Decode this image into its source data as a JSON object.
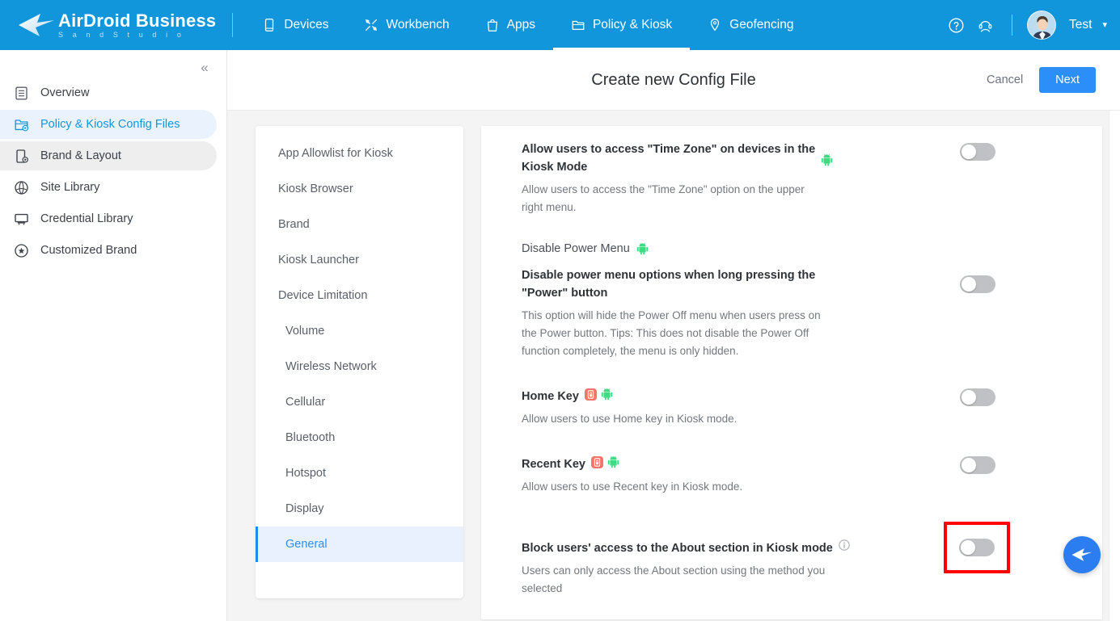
{
  "header": {
    "brand_name": "AirDroid Business",
    "brand_sub": "S a n d   S t u d i o",
    "nav": [
      {
        "label": "Devices",
        "icon": "device-icon",
        "active": false
      },
      {
        "label": "Workbench",
        "icon": "tools-icon",
        "active": false
      },
      {
        "label": "Apps",
        "icon": "apps-bag-icon",
        "active": false
      },
      {
        "label": "Policy & Kiosk",
        "icon": "folder-icon",
        "active": true
      },
      {
        "label": "Geofencing",
        "icon": "location-pin-icon",
        "active": false
      }
    ],
    "help_icon": "help-circle-icon",
    "support_icon": "headset-support-icon",
    "user_name": "Test",
    "user_caret": "⌄",
    "avatar_alt": "user-avatar"
  },
  "sidebar": {
    "collapse_icon": "«",
    "items": [
      {
        "label": "Overview",
        "icon": "document-icon",
        "state": ""
      },
      {
        "label": "Policy & Kiosk Config Files",
        "icon": "folder-gear-icon",
        "state": "selected"
      },
      {
        "label": "Brand & Layout",
        "icon": "device-gear-icon",
        "state": "hovered"
      },
      {
        "label": "Site Library",
        "icon": "globe-icon",
        "state": ""
      },
      {
        "label": "Credential Library",
        "icon": "credential-icon",
        "state": ""
      },
      {
        "label": "Customized Brand",
        "icon": "star-circle-icon",
        "state": ""
      }
    ]
  },
  "page": {
    "title": "Create new Config File",
    "cancel_label": "Cancel",
    "next_label": "Next"
  },
  "subnav": {
    "items": [
      {
        "label": "App Allowlist for Kiosk",
        "child": false,
        "selected": false
      },
      {
        "label": "Kiosk Browser",
        "child": false,
        "selected": false
      },
      {
        "label": "Brand",
        "child": false,
        "selected": false
      },
      {
        "label": "Kiosk Launcher",
        "child": false,
        "selected": false
      },
      {
        "label": "Device Limitation",
        "child": false,
        "selected": false
      },
      {
        "label": "Volume",
        "child": true,
        "selected": false
      },
      {
        "label": "Wireless Network",
        "child": true,
        "selected": false
      },
      {
        "label": "Cellular",
        "child": true,
        "selected": false
      },
      {
        "label": "Bluetooth",
        "child": true,
        "selected": false
      },
      {
        "label": "Hotspot",
        "child": true,
        "selected": false
      },
      {
        "label": "Display",
        "child": true,
        "selected": false
      },
      {
        "label": "General",
        "child": true,
        "selected": true
      }
    ]
  },
  "settings": {
    "rows": [
      {
        "group_label": null,
        "title": "Allow users to access \"Time Zone\" on devices in the Kiosk Mode",
        "desc": "Allow users to access the \"Time Zone\" option on the upper right menu.",
        "badges": [
          "android-robot-icon"
        ],
        "toggle_on": false,
        "highlighted": false
      },
      {
        "group_label": "Disable Power Menu",
        "group_badges": [
          "android-robot-icon"
        ],
        "title": "Disable power menu options when long pressing the \"Power\" button",
        "desc": "This option will hide the Power Off menu when users press on the Power button. Tips: This does not disable the Power Off function completely, the menu is only hidden.",
        "badges": [],
        "toggle_on": false,
        "highlighted": false
      },
      {
        "group_label": null,
        "title": "Home Key",
        "desc": "Allow users to use Home key in Kiosk mode.",
        "badges": [
          "red-device-lock-icon",
          "android-robot-icon"
        ],
        "toggle_on": false,
        "highlighted": false
      },
      {
        "group_label": null,
        "title": "Recent Key",
        "desc": "Allow users to use Recent key in Kiosk mode.",
        "badges": [
          "red-device-lock-icon",
          "android-robot-icon"
        ],
        "toggle_on": false,
        "highlighted": false
      },
      {
        "group_label": null,
        "title": "Block users' access to the About section in Kiosk mode",
        "desc": "Users can only access the About section using the method you selected",
        "badges": [
          "info-circle-icon"
        ],
        "toggle_on": false,
        "highlighted": true
      }
    ]
  },
  "fab": {
    "icon": "airdroid-arrow-icon"
  },
  "colors": {
    "brand_blue": "#1296db",
    "accent_blue": "#2c8ef8",
    "selected_bg": "#e8f1fd",
    "android_green": "#3ddc84",
    "badge_red": "#fa7268",
    "highlight_red": "#fe0000",
    "content_bg": "#f4f4f5"
  }
}
